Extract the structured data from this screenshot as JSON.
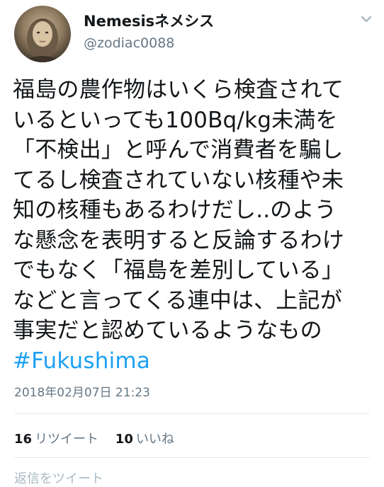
{
  "user": {
    "display_name": "Nemesisネメシス",
    "handle": "@zodiac0088"
  },
  "menu_icon": "chevron-down-icon",
  "tweet": {
    "lines": [
      "福島の農作物はいくら検査されて",
      "いるといっても100Bq/kg未満を",
      "「不検出」と呼んで消費者を騙し",
      "てるし検査されていない核種や未",
      "知の核種もあるわけだし..のよう",
      "な懸念を表明すると反論するわけ",
      "でもなく「福島を差別している」",
      "などと言ってくる連中は、上記が",
      "事実だと認めているようなもの"
    ],
    "hashtag": "#Fukushima"
  },
  "timestamp": "2018年02月07日 21:23",
  "stats": {
    "retweet_count": "16",
    "retweet_label": "リツイート",
    "like_count": "10",
    "like_label": "いいね"
  },
  "reply": {
    "placeholder": "返信をツイート"
  },
  "colors": {
    "link": "#1da1f2",
    "secondary_text": "#657786",
    "divider": "#e1e8ed"
  }
}
